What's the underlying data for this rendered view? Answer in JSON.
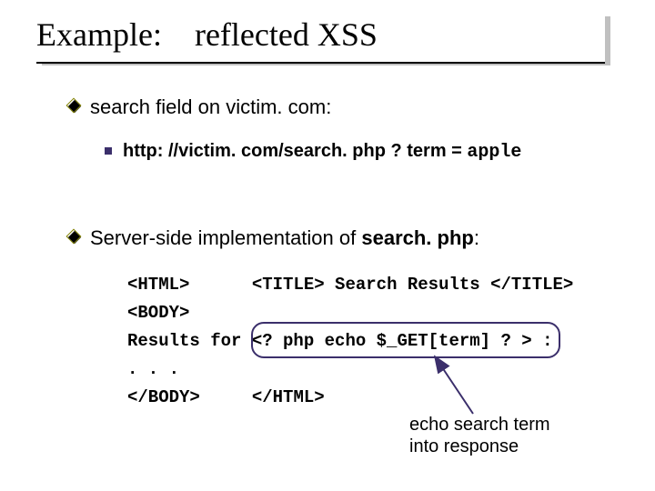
{
  "title_part1": "Example:",
  "title_part2": "reflected XSS",
  "bullet1": "search field on victim. com:",
  "sub1_prefix": "http: //victim. com/search. php ? term = ",
  "sub1_term": "apple",
  "bullet2_prefix": "Server-side implementation of  ",
  "bullet2_file": "search. php",
  "bullet2_suffix": ":",
  "code": {
    "l1a": "<HTML>",
    "l1b": "<TITLE> Search Results </TITLE>",
    "l2": "<BODY>",
    "l3a": "Results for",
    "l3b": "<? php echo $_GET[term] ? >",
    "l3c": " :",
    "l4": ". . .",
    "l5a": "</BODY>",
    "l5b": "</HTML>"
  },
  "annotation_l1": "echo search term",
  "annotation_l2": "into response"
}
